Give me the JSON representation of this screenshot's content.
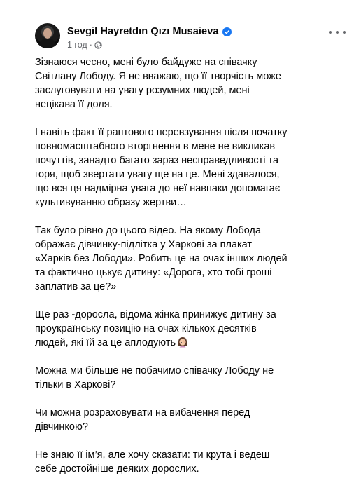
{
  "post": {
    "author": "Sevgil Hayretdın Qızı Musaieva",
    "time": "1 год",
    "separator": "·",
    "icons": {
      "verified": "verified-badge-icon",
      "audience": "globe-icon",
      "more": "more-options-icon",
      "emoji": "woman-facepalming-emoji"
    },
    "colors": {
      "verified": "#1877f2",
      "meta": "#65676b",
      "text": "#050505"
    },
    "paragraphs": [
      "Зізнаюся чесно, мені було байдуже на співачку\nСвітлану Лободу.  Я не вважаю, що її творчість може\nзаслуговувати на увагу розумних людей, мені\nнецікава її доля.",
      "І навіть факт її раптового перевзування після початку\nповномасштабного вторгнення в мене не викликав\nпочуттів, занадто багато зараз несправедливості та\nгоря, щоб звертати увагу ще на це. Мені здавалося,\nщо вся ця надмірна увага до неї навпаки допомагає\nкультивуванню образу жертви…",
      "Так було рівно до цього відео. На якому Лобода\nображає дівчинку-підлітка у Харкові за плакат\n«Харків без Лободи». Робить це на очах інших людей\nта фактично цькує дитину: «Дорога, хто тобі гроші\nзаплатив за це?»",
      "Ще раз -доросла, відома жінка принижує дитину за\nпроукраїнську позицію на очах кількох десятків\nлюдей, які їй за це аплодують",
      "Можна ми більше не побачимо співачку Лободу не\nтільки в Харкові?",
      "Чи можна розраховувати на вибачення перед\nдівчинкою?",
      "Не знаю її ім’я, але хочу сказати: ти крута і ведеш\nсебе достойніше деяких дорослих."
    ]
  }
}
